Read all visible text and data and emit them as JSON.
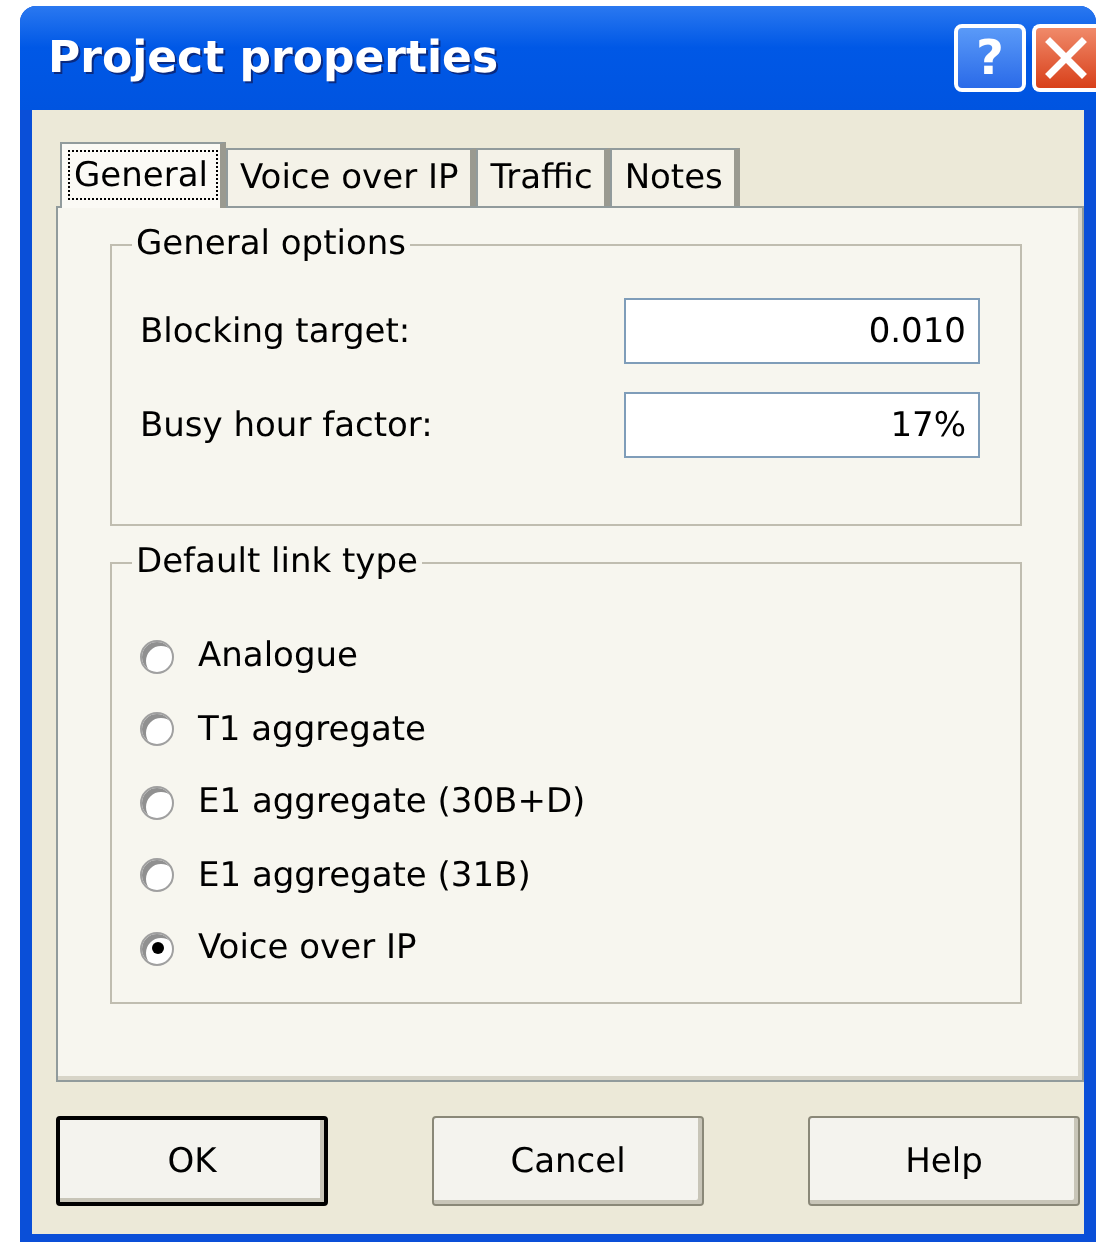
{
  "window": {
    "title": "Project properties",
    "help_button": "?"
  },
  "tabs": [
    {
      "label": "General",
      "selected": true
    },
    {
      "label": "Voice over IP",
      "selected": false
    },
    {
      "label": "Traffic",
      "selected": false
    },
    {
      "label": "Notes",
      "selected": false
    }
  ],
  "general_options": {
    "title": "General options",
    "fields": [
      {
        "label": "Blocking target:",
        "value": "0.010"
      },
      {
        "label": "Busy hour factor:",
        "value": "17%"
      }
    ]
  },
  "default_link_type": {
    "title": "Default link type",
    "options": [
      {
        "label": "Analogue",
        "selected": false
      },
      {
        "label": "T1 aggregate",
        "selected": false
      },
      {
        "label": "E1 aggregate (30B+D)",
        "selected": false
      },
      {
        "label": "E1 aggregate (31B)",
        "selected": false
      },
      {
        "label": "Voice over IP",
        "selected": true
      }
    ]
  },
  "buttons": [
    {
      "label": "OK",
      "default": true
    },
    {
      "label": "Cancel",
      "default": false
    },
    {
      "label": "Help",
      "default": false
    }
  ]
}
